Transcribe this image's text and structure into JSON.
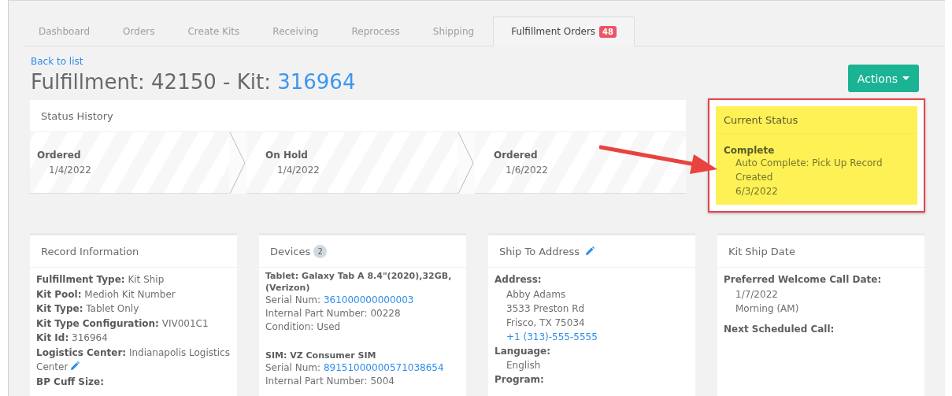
{
  "tabs": [
    {
      "label": "Dashboard",
      "selected": false
    },
    {
      "label": "Orders",
      "selected": false
    },
    {
      "label": "Create Kits",
      "selected": false
    },
    {
      "label": "Receiving",
      "selected": false
    },
    {
      "label": "Reprocess",
      "selected": false
    },
    {
      "label": "Shipping",
      "selected": false
    },
    {
      "label": "Fulfillment Orders",
      "selected": true,
      "badge": "48"
    }
  ],
  "back_link": "Back to list",
  "title": {
    "text": "Fulfillment: 42150 - Kit:",
    "kit": "316964"
  },
  "actions_button": "Actions",
  "status_history": {
    "title": "Status History",
    "steps": [
      {
        "status": "Ordered",
        "date": "1/4/2022"
      },
      {
        "status": "On Hold",
        "date": "1/4/2022"
      },
      {
        "status": "Ordered",
        "date": "1/6/2022"
      }
    ]
  },
  "current_status": {
    "title": "Current Status",
    "highlighted": true,
    "status": "Complete",
    "note": "Auto Complete: Pick Up Record Created",
    "date": "6/3/2022"
  },
  "record_information": {
    "title": "Record Information",
    "fields": [
      {
        "label": "Fulfillment Type:",
        "value": "Kit Ship",
        "editable": false
      },
      {
        "label": "Kit Pool:",
        "value": "Medioh Kit Number",
        "editable": false
      },
      {
        "label": "Kit Type:",
        "value": "Tablet Only",
        "editable": false
      },
      {
        "label": "Kit Type Configuration:",
        "value": "VIV001C1",
        "editable": false
      },
      {
        "label": "Kit Id:",
        "value": "316964",
        "editable": false
      },
      {
        "label": "Logistics Center:",
        "value": "Indianapolis Logistics Center",
        "editable": true
      },
      {
        "label": "BP Cuff Size:",
        "editable": false
      }
    ]
  },
  "devices": {
    "title": "Devices",
    "count": "2",
    "items": [
      {
        "name": "Tablet: Galaxy Tab A 8.4\"(2020),32GB, (Verizon)",
        "lines": [
          {
            "label": "Serial Num:",
            "value": "361000000000003",
            "link": true
          },
          {
            "label": "Internal Part Number:",
            "value": "00228",
            "link": false
          },
          {
            "label": "Condition:",
            "value": "Used",
            "link": false
          }
        ]
      },
      {
        "name": "SIM: VZ Consumer SIM",
        "lines": [
          {
            "label": "Serial Num:",
            "value": "89151000000571038654",
            "link": true
          },
          {
            "label": "Internal Part Number:",
            "value": "5004",
            "link": false
          }
        ]
      }
    ]
  },
  "ship_to": {
    "title": "Ship To Address",
    "editable": true,
    "sections": [
      {
        "label": "Address:",
        "lines": [
          {
            "text": "Abby Adams",
            "link": false
          },
          {
            "text": "3533 Preston Rd",
            "link": false
          },
          {
            "text": "Frisco, TX 75034",
            "link": false
          },
          {
            "text": "+1 (313)-555-5555",
            "link": true
          }
        ]
      },
      {
        "label": "Language:",
        "lines": [
          {
            "text": "English",
            "link": false
          }
        ]
      },
      {
        "label": "Program:"
      }
    ]
  },
  "kit_ship_date": {
    "title": "Kit Ship Date",
    "sections": [
      {
        "label": "Preferred Welcome Call Date:",
        "lines": [
          {
            "text": "1/7/2022",
            "link": false
          },
          {
            "text": "Morning (AM)",
            "link": false
          }
        ]
      },
      {
        "label": "Next Scheduled Call:"
      }
    ]
  }
}
